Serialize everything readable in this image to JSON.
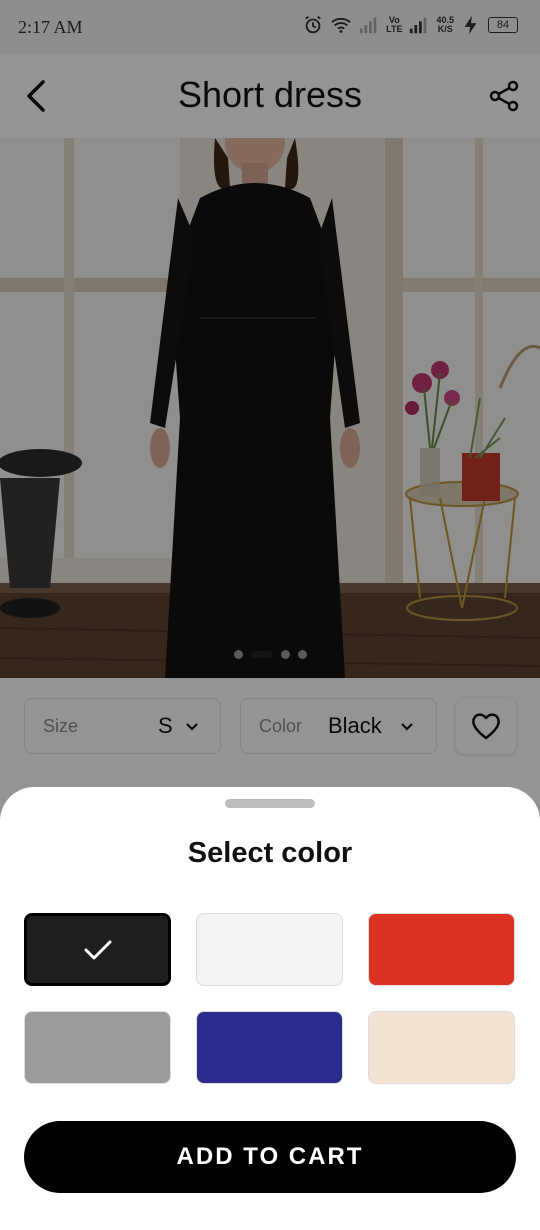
{
  "status_bar": {
    "time": "2:17 AM",
    "network_speed_value": "40.5",
    "network_speed_unit": "K/S",
    "volte_label_top": "Vo",
    "volte_label_bottom": "LTE",
    "battery": "84"
  },
  "header": {
    "title": "Short dress"
  },
  "gallery": {
    "image_count": 4,
    "active_index": 1
  },
  "selectors": {
    "size_label": "Size",
    "size_value": "S",
    "color_label": "Color",
    "color_value": "Black"
  },
  "color_sheet": {
    "title": "Select color",
    "swatches": [
      {
        "color": "#1e1e1e",
        "selected": true
      },
      {
        "color": "#f4f4f4",
        "selected": false
      },
      {
        "color": "#dc3222",
        "selected": false
      },
      {
        "color": "#9b9b9b",
        "selected": false
      },
      {
        "color": "#2b2b8c",
        "selected": false
      },
      {
        "color": "#f3e3d5",
        "selected": false
      }
    ],
    "add_to_cart_label": "ADD TO CART"
  }
}
